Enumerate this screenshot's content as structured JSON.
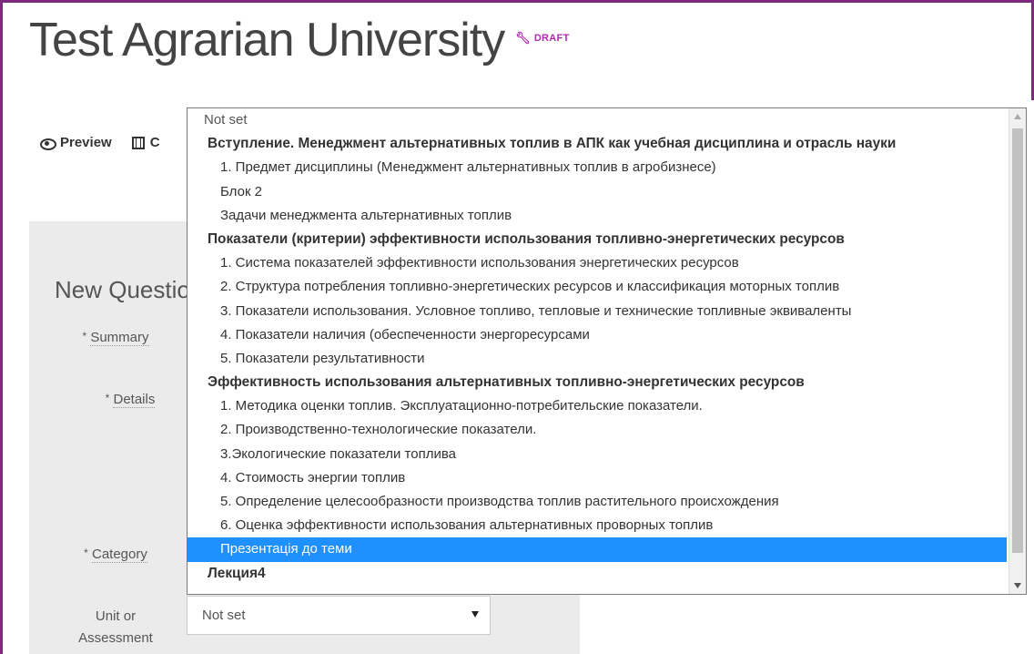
{
  "header": {
    "site_title": "Test Agrarian University",
    "draft_label": "DRAFT"
  },
  "toolbar": {
    "preview_label": "Preview",
    "second_label": "C"
  },
  "form": {
    "heading": "New Question",
    "fields": {
      "summary_label": "Summary",
      "details_label": "Details",
      "category_label": "Category",
      "unit_label_1": "Unit or",
      "unit_label_2": "Assessment",
      "required_mark": "*"
    },
    "unit_select_value": "Not set"
  },
  "dropdown": {
    "items": [
      {
        "type": "top",
        "label": "Not set"
      },
      {
        "type": "group",
        "label": "Вступление. Менеджмент альтернативных топлив в АПК как учебная дисциплина и отрасль науки"
      },
      {
        "type": "opt",
        "label": "1. Предмет дисциплины (Менеджмент альтернативных топлив в агробизнесе)"
      },
      {
        "type": "opt",
        "label": "Блок 2"
      },
      {
        "type": "opt",
        "label": "Задачи менеджмента альтернативных топлив"
      },
      {
        "type": "group",
        "label": "Показатели (критерии) эффективности использования топливно-энергетических ресурсов"
      },
      {
        "type": "opt",
        "label": "1. Система показателей эффективности использования энергетических ресурсов"
      },
      {
        "type": "opt",
        "label": "2. Структура потребления топливно-энергетических ресурсов и классификация моторных топлив"
      },
      {
        "type": "opt",
        "label": "3. Показатели использования. Условное топливо, тепловые и технические топливные эквиваленты"
      },
      {
        "type": "opt",
        "label": "4. Показатели наличия (обеспеченности энергоресурсами"
      },
      {
        "type": "opt",
        "label": "5. Показатели результативности"
      },
      {
        "type": "group",
        "label": "Эффективность использования альтернативных топливно-энергетических ресурсов"
      },
      {
        "type": "opt",
        "label": "1. Методика оценки топлив. Эксплуатационно-потребительские показатели."
      },
      {
        "type": "opt",
        "label": "2. Производственно-технологические показатели."
      },
      {
        "type": "opt",
        "label": "3.Экологические показатели топлива"
      },
      {
        "type": "opt",
        "label": "4. Стоимость энергии топлив"
      },
      {
        "type": "opt",
        "label": "5. Определение целесообразности производства топлив растительного происхождения"
      },
      {
        "type": "opt",
        "label": "6. Оценка эффективности использования альтернативных проворных топлив"
      },
      {
        "type": "opt",
        "label": "Презентація до теми",
        "selected": true
      },
      {
        "type": "group",
        "label": "Лекция4"
      }
    ]
  },
  "colors": {
    "frame": "#7b2a7e",
    "draft": "#b22bb0",
    "selection": "#1e90ff",
    "panel_bg": "#ebebeb"
  }
}
